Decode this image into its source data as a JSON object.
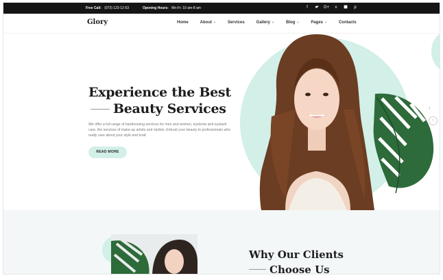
{
  "topbar": {
    "call_label": "Free Call:",
    "call_value": "(073) 123-12-53",
    "hours_label": "Opening Hours:",
    "hours_value": "Mn-Fr: 10 am-8 am",
    "social": [
      "f",
      "t",
      "G+",
      "v",
      "tumblr",
      "p"
    ]
  },
  "nav": {
    "logo": "Glory",
    "menu": [
      {
        "label": "Home",
        "dropdown": false
      },
      {
        "label": "About",
        "dropdown": true
      },
      {
        "label": "Services",
        "dropdown": false
      },
      {
        "label": "Gallery",
        "dropdown": true
      },
      {
        "label": "Blog",
        "dropdown": true
      },
      {
        "label": "Pages",
        "dropdown": true
      },
      {
        "label": "Contacts",
        "dropdown": false
      }
    ]
  },
  "hero": {
    "title_line1": "Experience the Best",
    "title_line2": "Beauty Services",
    "description": "We offer a full range of hairdressing services for men and women, eyebrow and eyelash care, the services of make-up artists and stylists. Entrust your beauty to professionals who really care about your style and look!",
    "button": "READ MORE"
  },
  "section2": {
    "title_line1": "Why Our Clients",
    "title_line2": "Choose Us"
  },
  "colors": {
    "accent": "#d2efe8",
    "topbar": "#151515",
    "leaf": "#2d6b3a"
  },
  "icons": [
    "facebook-icon",
    "twitter-icon",
    "google-plus-icon",
    "vimeo-icon",
    "tumblr-icon",
    "pinterest-icon",
    "arrow-up-icon",
    "chevron-right-icon"
  ]
}
